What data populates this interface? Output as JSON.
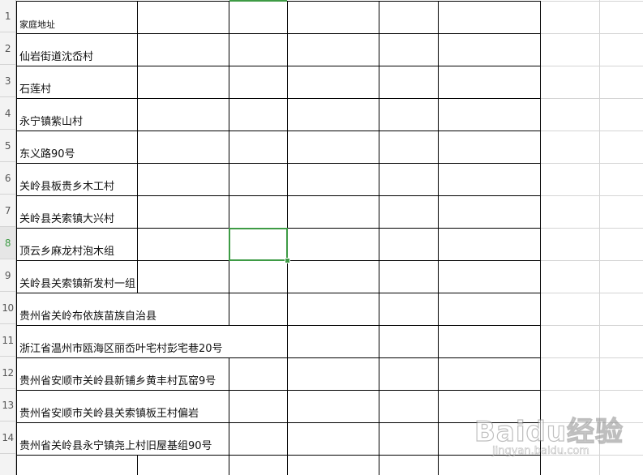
{
  "spreadsheet": {
    "rows": [
      {
        "num": "1",
        "text": "家庭地址"
      },
      {
        "num": "2",
        "text": "仙岩街道沈岙村"
      },
      {
        "num": "3",
        "text": "石莲村"
      },
      {
        "num": "4",
        "text": "永宁镇紫山村"
      },
      {
        "num": "5",
        "text": "东义路90号"
      },
      {
        "num": "6",
        "text": "关岭县板贵乡木工村"
      },
      {
        "num": "7",
        "text": "关岭县关索镇大兴村"
      },
      {
        "num": "8",
        "text": "顶云乡麻龙村泡木组"
      },
      {
        "num": "9",
        "text": "关岭县关索镇新发村一组"
      },
      {
        "num": "10",
        "text": "贵州省关岭布依族苗族自治县"
      },
      {
        "num": "11",
        "text": "浙江省温州市瓯海区丽岙叶宅村彭宅巷20号"
      },
      {
        "num": "12",
        "text": "贵州省安顺市关岭县新铺乡黄丰村瓦窑9号"
      },
      {
        "num": "13",
        "text": "贵州省安顺市关岭县关索镇板王村偏岩"
      },
      {
        "num": "14",
        "text": "贵州省关岭县永宁镇尧上村旧屋基组90号"
      }
    ],
    "active_row": "8",
    "colors": {
      "selection": "#3e9b45",
      "border": "#000000",
      "gridline": "#d4d4d4"
    }
  },
  "watermark": {
    "logo": "Baidu经验",
    "url": "jingyan.baidu.com"
  }
}
